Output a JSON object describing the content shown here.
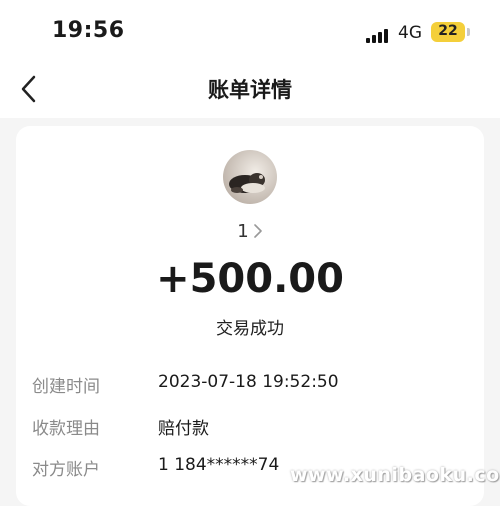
{
  "status_bar": {
    "time": "19:56",
    "network": "4G",
    "battery": "22"
  },
  "navbar": {
    "title": "账单详情"
  },
  "counterpart": {
    "name": "1"
  },
  "transaction": {
    "amount": "+500.00",
    "status": "交易成功"
  },
  "details": [
    {
      "key": "创建时间",
      "value": "2023-07-18 19:52:50"
    },
    {
      "key": "收款理由",
      "value": "赔付款"
    },
    {
      "key": "对方账户",
      "value": "1 184******74"
    }
  ],
  "watermark": "www.xunibaoku.com",
  "colors": {
    "battery": "#f4cf3a",
    "card": "#ffffff",
    "background": "#f5f5f5",
    "label": "#8a8a8a"
  },
  "icons": [
    "signal-icon",
    "back-chevron-icon",
    "chevron-right-icon"
  ]
}
